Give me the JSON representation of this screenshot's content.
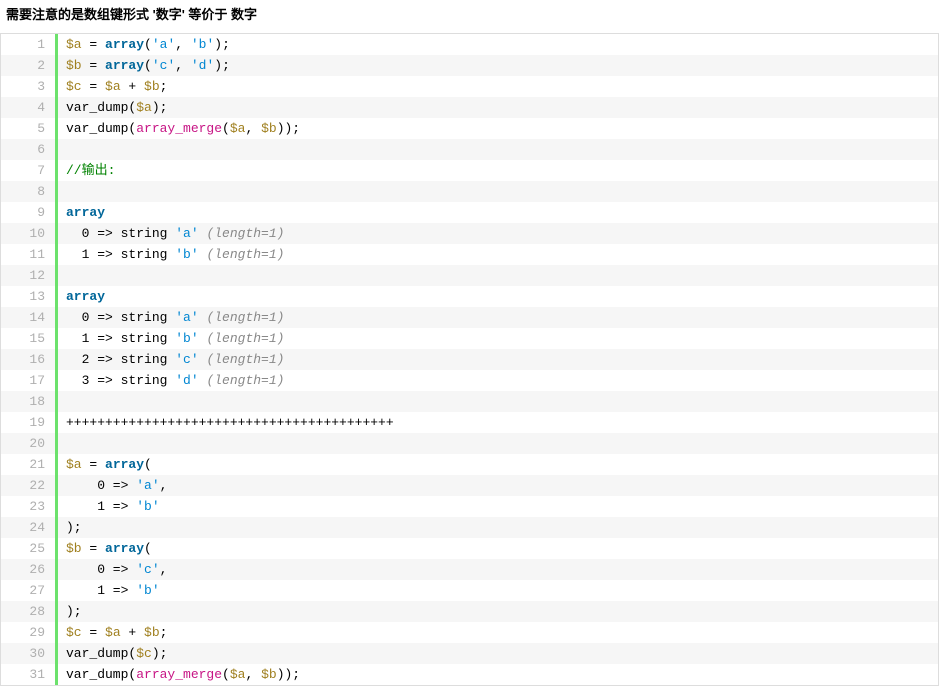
{
  "heading": "需要注意的是数组键形式 '数字' 等价于 数字",
  "lines": [
    [
      {
        "t": "$a",
        "c": "tok-var"
      },
      {
        "t": " = "
      },
      {
        "t": "array",
        "c": "tok-kw"
      },
      {
        "t": "("
      },
      {
        "t": "'a'",
        "c": "tok-str"
      },
      {
        "t": ", "
      },
      {
        "t": "'b'",
        "c": "tok-str"
      },
      {
        "t": ");"
      }
    ],
    [
      {
        "t": "$b",
        "c": "tok-var"
      },
      {
        "t": " = "
      },
      {
        "t": "array",
        "c": "tok-kw"
      },
      {
        "t": "("
      },
      {
        "t": "'c'",
        "c": "tok-str"
      },
      {
        "t": ", "
      },
      {
        "t": "'d'",
        "c": "tok-str"
      },
      {
        "t": ");"
      }
    ],
    [
      {
        "t": "$c",
        "c": "tok-var"
      },
      {
        "t": " = "
      },
      {
        "t": "$a",
        "c": "tok-var"
      },
      {
        "t": " + "
      },
      {
        "t": "$b",
        "c": "tok-var"
      },
      {
        "t": ";"
      }
    ],
    [
      {
        "t": "var_dump("
      },
      {
        "t": "$a",
        "c": "tok-var"
      },
      {
        "t": ");"
      }
    ],
    [
      {
        "t": "var_dump("
      },
      {
        "t": "array_merge",
        "c": "tok-fn"
      },
      {
        "t": "("
      },
      {
        "t": "$a",
        "c": "tok-var"
      },
      {
        "t": ", "
      },
      {
        "t": "$b",
        "c": "tok-var"
      },
      {
        "t": "));"
      }
    ],
    [],
    [
      {
        "t": "//输出:",
        "c": "tok-cmt"
      }
    ],
    [],
    [
      {
        "t": "array",
        "c": "tok-kw"
      }
    ],
    [
      {
        "t": "  0 => string "
      },
      {
        "t": "'a'",
        "c": "tok-str"
      },
      {
        "t": " "
      },
      {
        "t": "(length=1)",
        "c": "tok-len"
      }
    ],
    [
      {
        "t": "  1 => string "
      },
      {
        "t": "'b'",
        "c": "tok-str"
      },
      {
        "t": " "
      },
      {
        "t": "(length=1)",
        "c": "tok-len"
      }
    ],
    [],
    [
      {
        "t": "array",
        "c": "tok-kw"
      }
    ],
    [
      {
        "t": "  0 => string "
      },
      {
        "t": "'a'",
        "c": "tok-str"
      },
      {
        "t": " "
      },
      {
        "t": "(length=1)",
        "c": "tok-len"
      }
    ],
    [
      {
        "t": "  1 => string "
      },
      {
        "t": "'b'",
        "c": "tok-str"
      },
      {
        "t": " "
      },
      {
        "t": "(length=1)",
        "c": "tok-len"
      }
    ],
    [
      {
        "t": "  2 => string "
      },
      {
        "t": "'c'",
        "c": "tok-str"
      },
      {
        "t": " "
      },
      {
        "t": "(length=1)",
        "c": "tok-len"
      }
    ],
    [
      {
        "t": "  3 => string "
      },
      {
        "t": "'d'",
        "c": "tok-str"
      },
      {
        "t": " "
      },
      {
        "t": "(length=1)",
        "c": "tok-len"
      }
    ],
    [],
    [
      {
        "t": "++++++++++++++++++++++++++++++++++++++++++"
      }
    ],
    [],
    [
      {
        "t": "$a",
        "c": "tok-var"
      },
      {
        "t": " = "
      },
      {
        "t": "array",
        "c": "tok-kw"
      },
      {
        "t": "("
      }
    ],
    [
      {
        "t": "    0 => "
      },
      {
        "t": "'a'",
        "c": "tok-str"
      },
      {
        "t": ","
      }
    ],
    [
      {
        "t": "    1 => "
      },
      {
        "t": "'b'",
        "c": "tok-str"
      }
    ],
    [
      {
        "t": ");"
      }
    ],
    [
      {
        "t": "$b",
        "c": "tok-var"
      },
      {
        "t": " = "
      },
      {
        "t": "array",
        "c": "tok-kw"
      },
      {
        "t": "("
      }
    ],
    [
      {
        "t": "    0 => "
      },
      {
        "t": "'c'",
        "c": "tok-str"
      },
      {
        "t": ","
      }
    ],
    [
      {
        "t": "    1 => "
      },
      {
        "t": "'b'",
        "c": "tok-str"
      }
    ],
    [
      {
        "t": ");"
      }
    ],
    [
      {
        "t": "$c",
        "c": "tok-var"
      },
      {
        "t": " = "
      },
      {
        "t": "$a",
        "c": "tok-var"
      },
      {
        "t": " + "
      },
      {
        "t": "$b",
        "c": "tok-var"
      },
      {
        "t": ";"
      }
    ],
    [
      {
        "t": "var_dump("
      },
      {
        "t": "$c",
        "c": "tok-var"
      },
      {
        "t": ");"
      }
    ],
    [
      {
        "t": "var_dump("
      },
      {
        "t": "array_merge",
        "c": "tok-fn"
      },
      {
        "t": "("
      },
      {
        "t": "$a",
        "c": "tok-var"
      },
      {
        "t": ", "
      },
      {
        "t": "$b",
        "c": "tok-var"
      },
      {
        "t": "));"
      }
    ]
  ]
}
